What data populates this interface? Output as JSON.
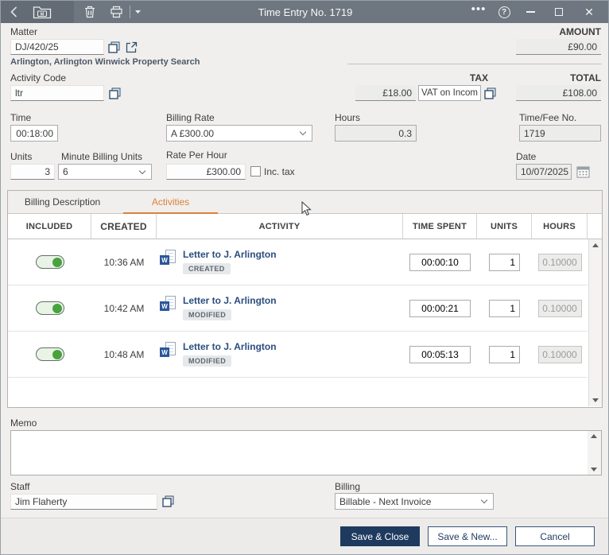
{
  "titlebar": {
    "title": "Time Entry No. 1719"
  },
  "matter": {
    "label": "Matter",
    "value": "DJ/420/25",
    "description": "Arlington, Arlington Winwick Property Search"
  },
  "amount": {
    "label": "AMOUNT",
    "value": "£90.00"
  },
  "tax": {
    "label": "TAX",
    "amount": "£18.00",
    "code": "VAT on Income"
  },
  "total": {
    "label": "TOTAL",
    "value": "£108.00"
  },
  "activity_code": {
    "label": "Activity Code",
    "value": "ltr"
  },
  "time": {
    "label": "Time",
    "value": "00:18:00"
  },
  "billing_rate": {
    "label": "Billing Rate",
    "value": "A £300.00"
  },
  "hours": {
    "label": "Hours",
    "value": "0.3"
  },
  "time_fee_no": {
    "label": "Time/Fee No.",
    "value": "1719"
  },
  "units": {
    "label": "Units",
    "value": "3"
  },
  "minute_billing_units": {
    "label": "Minute Billing Units",
    "value": "6"
  },
  "rate_per_hour": {
    "label": "Rate Per Hour",
    "value": "£300.00",
    "inc_tax_label": "Inc. tax",
    "inc_tax_checked": false
  },
  "date": {
    "label": "Date",
    "value": "10/07/2025"
  },
  "tabs": {
    "billing_description": "Billing Description",
    "activities": "Activities"
  },
  "table": {
    "headers": [
      "INCLUDED",
      "CREATED",
      "ACTIVITY",
      "TIME SPENT",
      "UNITS",
      "HOURS"
    ],
    "rows": [
      {
        "included": true,
        "created": "10:36 AM",
        "activity": "Letter to J. Arlington",
        "status": "CREATED",
        "time_spent": "00:00:10",
        "units": "1",
        "hours": "0.10000"
      },
      {
        "included": true,
        "created": "10:42 AM",
        "activity": "Letter to J. Arlington",
        "status": "MODIFIED",
        "time_spent": "00:00:21",
        "units": "1",
        "hours": "0.10000"
      },
      {
        "included": true,
        "created": "10:48 AM",
        "activity": "Letter to J. Arlington",
        "status": "MODIFIED",
        "time_spent": "00:05:13",
        "units": "1",
        "hours": "0.10000"
      }
    ]
  },
  "memo": {
    "label": "Memo",
    "value": ""
  },
  "staff": {
    "label": "Staff",
    "value": "Jim Flaherty"
  },
  "billing": {
    "label": "Billing",
    "value": "Billable - Next Invoice"
  },
  "footer": {
    "save_close": "Save & Close",
    "save_new": "Save & New...",
    "cancel": "Cancel"
  },
  "colors": {
    "titlebar_gray": "#6e7780",
    "accent_orange": "#d9823b",
    "navy": "#1e3a5f",
    "toggle_green": "#48a33e",
    "word_blue": "#2b579a",
    "activity_link_blue": "#2b4d7e"
  }
}
